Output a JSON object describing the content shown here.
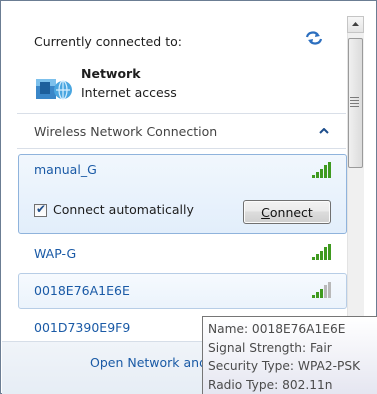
{
  "header": {
    "connected_label": "Currently connected to:",
    "network_name": "Network",
    "network_status": "Internet access",
    "icons": {
      "refresh": "refresh-icon",
      "network": "network-globe-icon"
    }
  },
  "wireless_section": {
    "title": "Wireless Network Connection",
    "chevron": "chevron-up-icon"
  },
  "networks": [
    {
      "name": "manual_G",
      "signal_level": 5,
      "selected": true
    },
    {
      "name": "WAP-G",
      "signal_level": 5,
      "selected": false
    },
    {
      "name": "0018E76A1E6E",
      "signal_level": 3,
      "selected": false
    },
    {
      "name": "001D7390E9F9",
      "signal_level": 5,
      "selected": false
    }
  ],
  "selected_network": {
    "connect_automatically_label": "Connect automatically",
    "connect_automatically_checked": true,
    "connect_button_label": "Connect"
  },
  "footer": {
    "link_text": "Open Network and Sharing Center"
  },
  "tooltip": {
    "name": "Name: 0018E76A1E6E",
    "signal": "Signal Strength: Fair",
    "security": "Security Type: WPA2-PSK",
    "radio": "Radio Type: 802.11n"
  },
  "colors": {
    "link": "#1a5aa6",
    "signal_green": "#3f9a1f",
    "signal_gray": "#b9b9b9",
    "selection_border": "#8fb3dc"
  }
}
